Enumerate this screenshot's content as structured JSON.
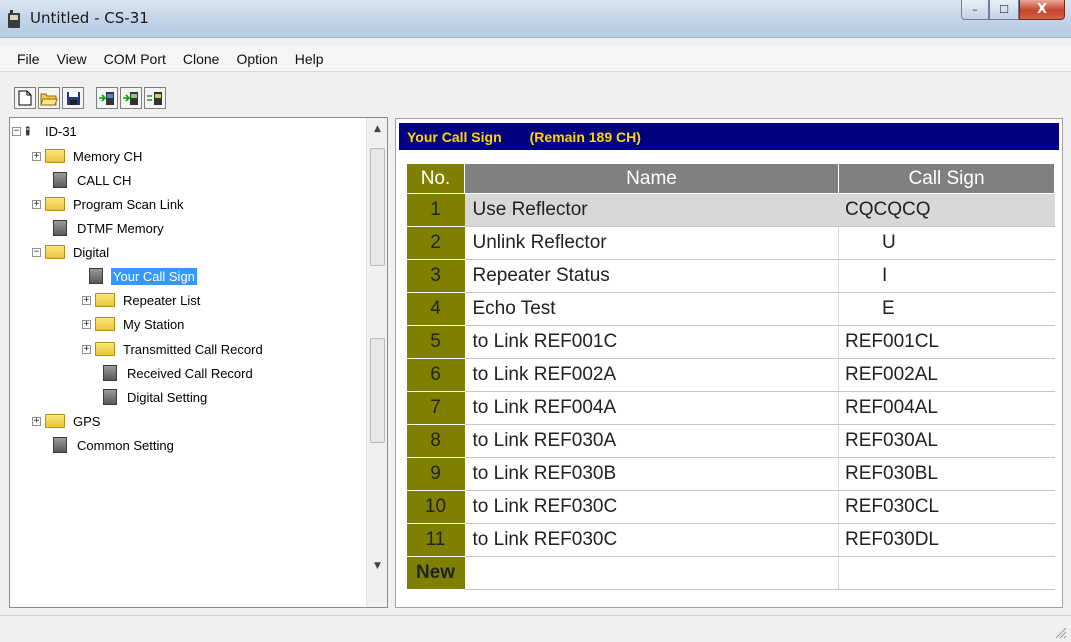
{
  "window": {
    "title": "Untitled - CS-31",
    "buttons": {
      "minimize": "–",
      "maximize": "☐",
      "close": "X"
    }
  },
  "menu": [
    "File",
    "View",
    "COM Port",
    "Clone",
    "Option",
    "Help"
  ],
  "toolbar": {
    "icons": [
      "new-file-icon",
      "open-folder-icon",
      "save-disk-icon",
      "radio-write-icon",
      "radio-read-icon",
      "radio-clone-icon"
    ]
  },
  "tree": {
    "root": "ID-31",
    "items": [
      {
        "label": "Memory CH"
      },
      {
        "label": "CALL CH"
      },
      {
        "label": "Program Scan Link"
      },
      {
        "label": "DTMF Memory"
      },
      {
        "label": "Digital"
      },
      {
        "label": "Your Call Sign"
      },
      {
        "label": "Repeater List"
      },
      {
        "label": "My Station"
      },
      {
        "label": "Transmitted Call Record"
      },
      {
        "label": "Received Call Record"
      },
      {
        "label": "Digital Setting"
      },
      {
        "label": "GPS"
      },
      {
        "label": "Common Setting"
      }
    ]
  },
  "panel": {
    "title": "Your Call Sign",
    "remain": "(Remain 189 CH)",
    "columns": {
      "no": "No.",
      "name": "Name",
      "callsign": "Call Sign"
    },
    "rows": [
      {
        "no": "1",
        "name": "Use Reflector",
        "callsign": "CQCQCQ"
      },
      {
        "no": "2",
        "name": "Unlink Reflector",
        "callsign": "       U"
      },
      {
        "no": "3",
        "name": "Repeater Status",
        "callsign": "       I"
      },
      {
        "no": "4",
        "name": "Echo Test",
        "callsign": "       E"
      },
      {
        "no": "5",
        "name": "to Link REF001C",
        "callsign": "REF001CL"
      },
      {
        "no": "6",
        "name": "to Link REF002A",
        "callsign": "REF002AL"
      },
      {
        "no": "7",
        "name": "to Link REF004A",
        "callsign": "REF004AL"
      },
      {
        "no": "8",
        "name": "to Link REF030A",
        "callsign": "REF030AL"
      },
      {
        "no": "9",
        "name": "to Link REF030B",
        "callsign": "REF030BL"
      },
      {
        "no": "10",
        "name": "to Link REF030C",
        "callsign": "REF030CL"
      },
      {
        "no": "11",
        "name": "to Link REF030C",
        "callsign": "REF030DL"
      },
      {
        "no": "New",
        "name": "",
        "callsign": ""
      }
    ]
  },
  "colors": {
    "header_bg": "#000080",
    "header_text": "#ffd700",
    "no_col_bg": "#808000",
    "col_header_bg": "#808080",
    "selected_tree_bg": "#3399ff"
  }
}
